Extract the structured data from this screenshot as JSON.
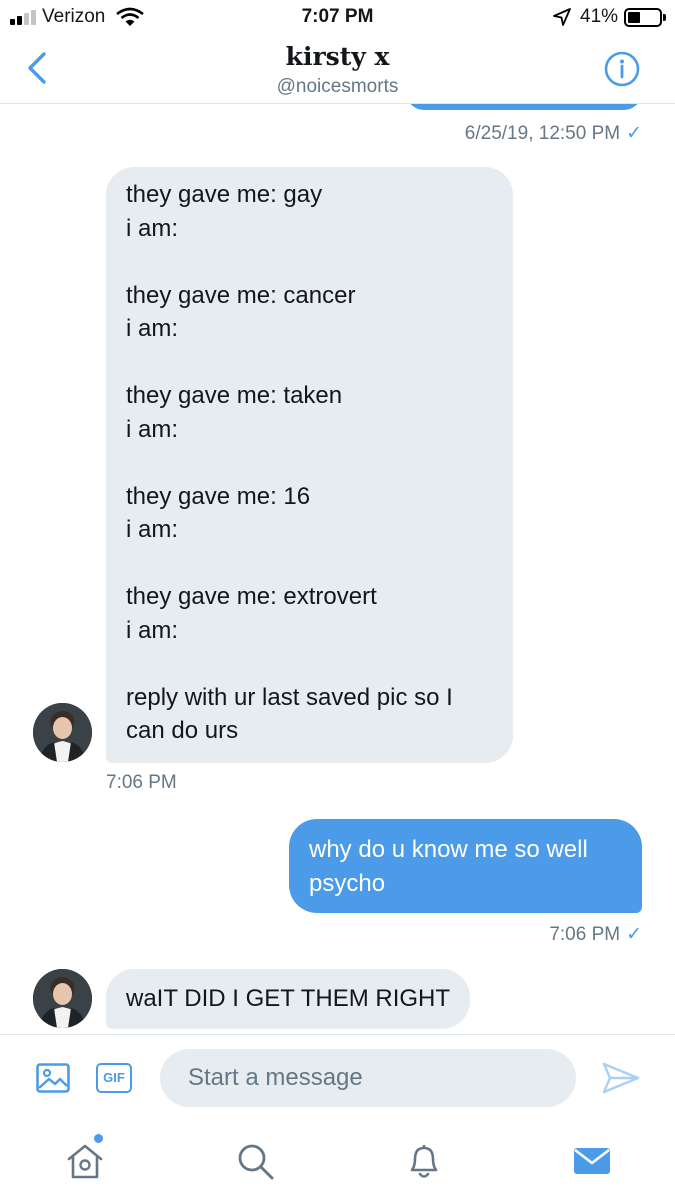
{
  "status_bar": {
    "carrier": "Verizon",
    "time": "7:07 PM",
    "battery_percent": "41%",
    "battery_level": 0.41,
    "signal_bars": 2
  },
  "header": {
    "title": "kirsty x",
    "handle": "@noicesmorts",
    "back_icon": "chevron-left-icon",
    "info_icon": "info-icon"
  },
  "conversation": {
    "previous_message_time": "6/25/19, 12:50 PM",
    "messages": [
      {
        "direction": "received",
        "text": "they gave me: gay\ni am:\n\nthey gave me: cancer\ni am:\n\nthey gave me: taken\ni am:\n\nthey gave me: 16\ni am:\n\nthey gave me: extrovert\ni am:\n\nreply with ur last saved pic so I\ncan do urs",
        "time": "7:06 PM"
      },
      {
        "direction": "sent",
        "text": "why do u know me so well psycho",
        "time": "7:06 PM"
      },
      {
        "direction": "received",
        "text": "waIT DID I GET THEM RIGHT"
      }
    ]
  },
  "composer": {
    "placeholder": "Start a message",
    "gif_label": "GIF",
    "media_icon": "image-icon",
    "send_icon": "send-icon"
  },
  "tab_bar": {
    "items": [
      "home-icon",
      "search-icon",
      "notifications-icon",
      "messages-icon"
    ],
    "active": "messages-icon"
  },
  "colors": {
    "accent": "#4b9be8",
    "received_bubble": "#e6ecf0",
    "meta_text": "#657786"
  }
}
